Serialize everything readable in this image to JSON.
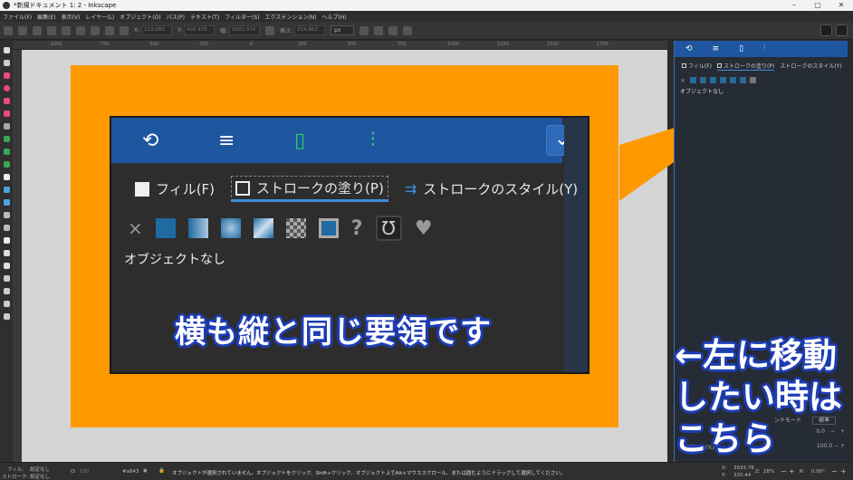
{
  "window": {
    "title": "*新規ドキュメント 1: 2 - Inkscape",
    "controls": [
      "–",
      "▢",
      "✕"
    ]
  },
  "menu": [
    "ファイル(F)",
    "編集(E)",
    "表示(V)",
    "レイヤー(L)",
    "オブジェクト(O)",
    "パス(P)",
    "テキスト(T)",
    "フィルター(S)",
    "エクステンション(N)",
    "ヘルプ(H)"
  ],
  "toolbar": {
    "x_label": "X:",
    "x_value": "210.083",
    "y_label": "Y:",
    "y_value": "402.476",
    "w_label": "幅:",
    "w_value": "1502.974",
    "h_label": "高さ:",
    "h_value": "214.863",
    "unit": "px"
  },
  "ruler_ticks": [
    "-1000",
    "-750",
    "-500",
    "-250",
    "0",
    "250",
    "500",
    "750",
    "1000",
    "1250",
    "1500",
    "1750"
  ],
  "zoomed_panel": {
    "tabs": [
      {
        "label": "フィル(F)"
      },
      {
        "label": "ストロークの塗り(P)"
      },
      {
        "label": "ストロークのスタイル(Y)"
      }
    ],
    "no_object": "オブジェクトなし",
    "header_icons": [
      "refresh-icon",
      "align-icon",
      "document-icon",
      "distribute-icon"
    ]
  },
  "captions": {
    "main": "横も縦と同じ要領です",
    "side_line1": "←左に移動",
    "side_line2": "したい時は",
    "side_line3": "こちら"
  },
  "dock": {
    "tab_fill": "フィル(F)",
    "tab_stroke_paint": "ストロークの塗り(P)",
    "tab_stroke_style": "ストロークのスタイル(Y)",
    "no_object": "オブジェクトなし",
    "blend_label": "ンドモード",
    "blend_value": "標準",
    "row1_value": "0.0",
    "row2_label": "不透明度 (%)",
    "row2_value": "100.0"
  },
  "status": {
    "fill_label": "フィル:",
    "fill_value": "設定なし",
    "stroke_label": "ストローク:",
    "stroke_value": "設定なし",
    "opacity_label": "O:",
    "opacity_value": "100",
    "layer": "#a843",
    "message": "オブジェクトが選択されていません。オブジェクトをクリック、Shift+クリック、オブジェクト上でAlt+マウススクロール、または囲むようにドラッグして選択してください。",
    "x_label": "X:",
    "x_value": "3033.78",
    "y_label": "Y:",
    "y_value": "320.44",
    "zoom_label": "Z:",
    "zoom_value": "28%",
    "rot_label": "R:",
    "rot_value": "0.00°"
  },
  "colors": {
    "accent": "#1e56a0",
    "page": "#ff9900",
    "caption_outline": "#1d3db5"
  }
}
